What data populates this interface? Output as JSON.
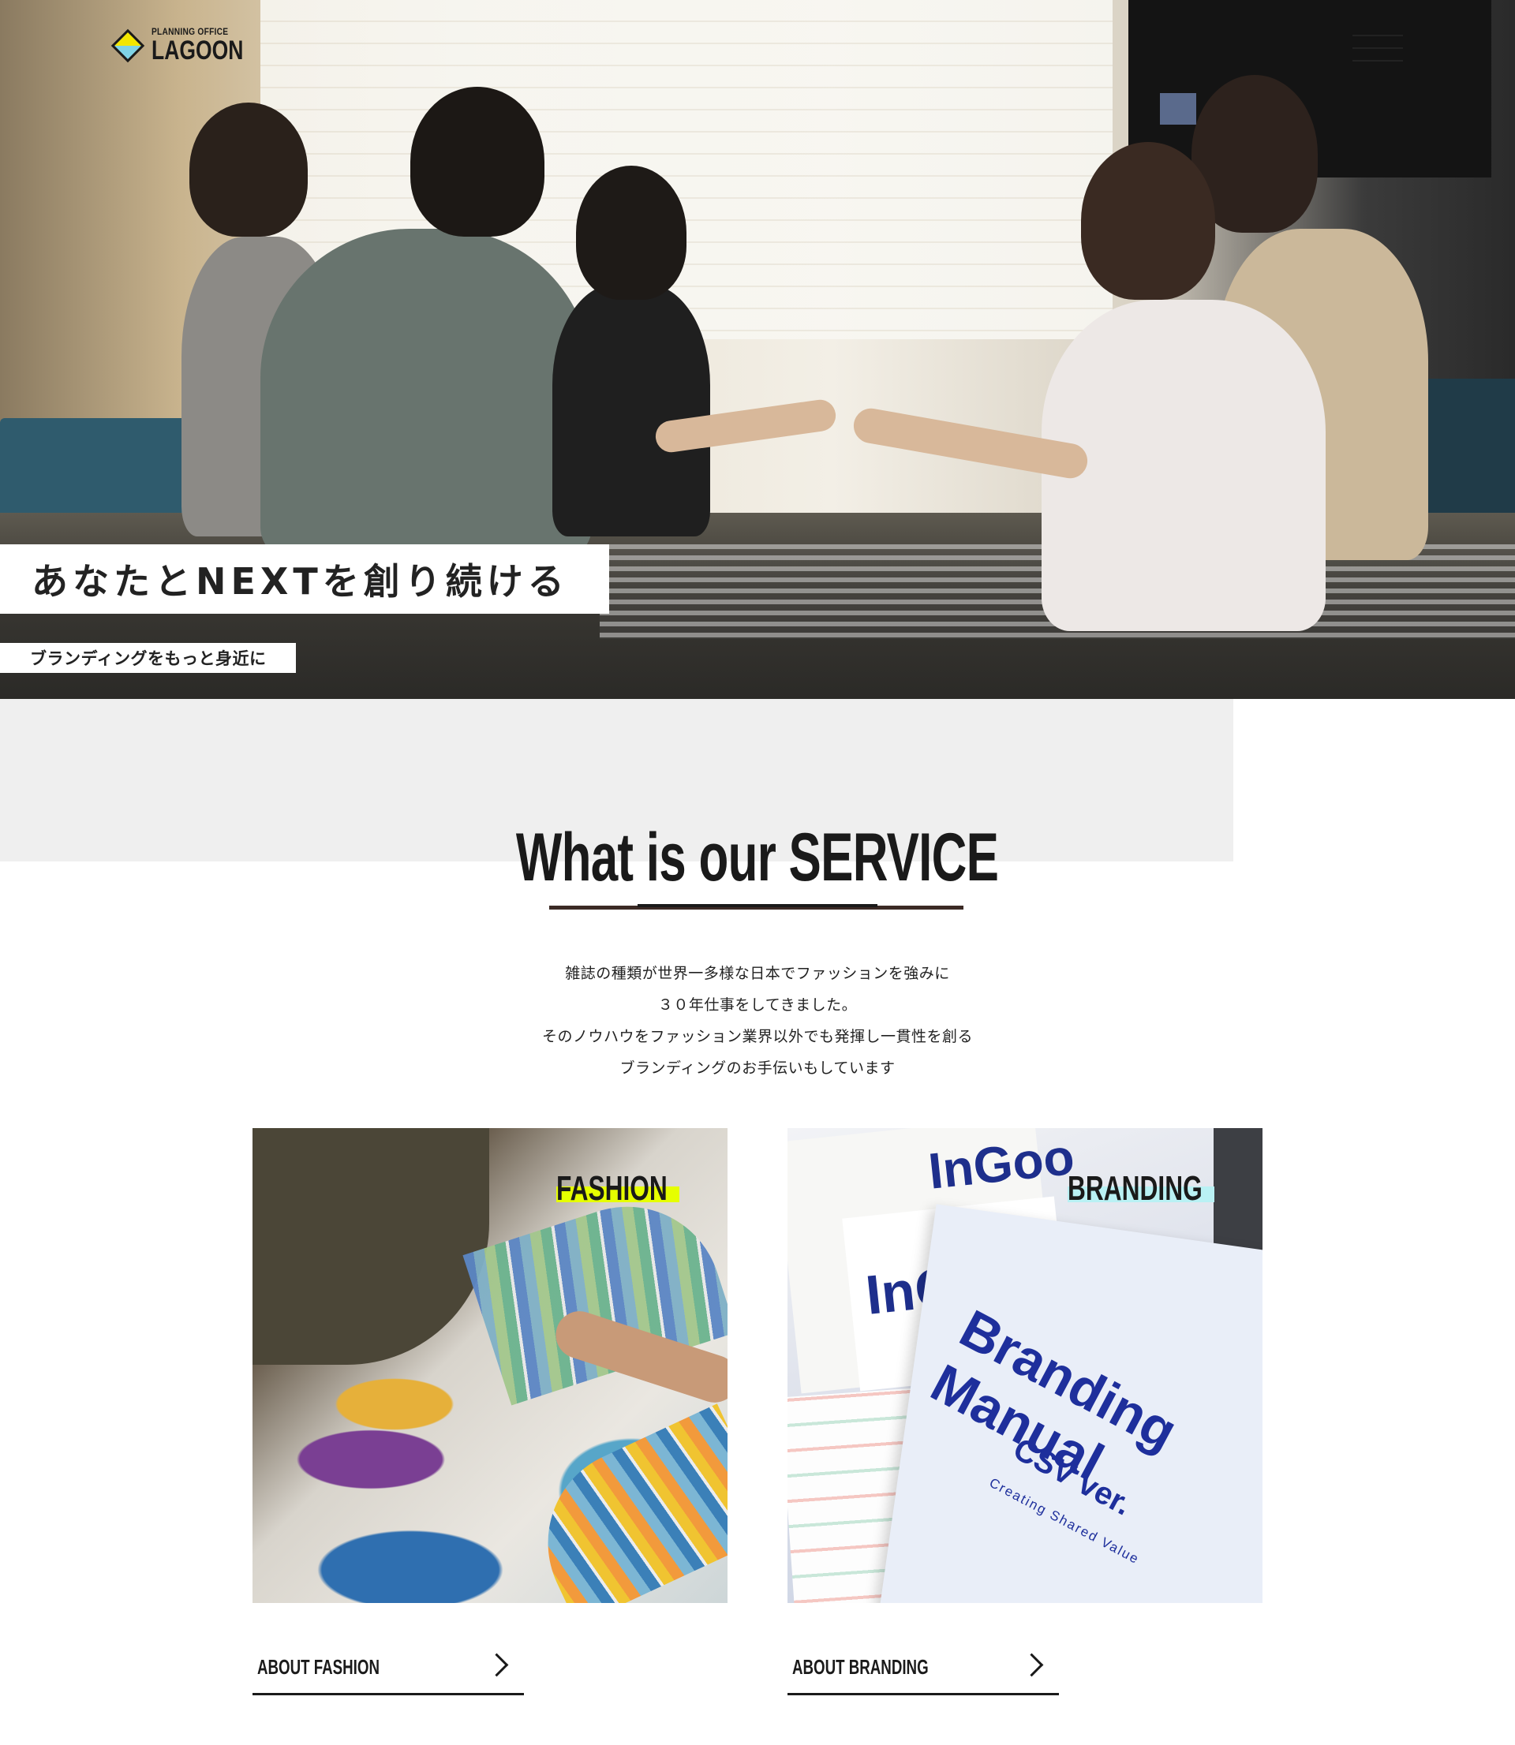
{
  "header": {
    "logo_small": "PLANNING OFFICE",
    "logo_big": "LAGOON",
    "menu_icon": "hamburger-menu-icon"
  },
  "hero": {
    "headline": "あなたとNEXTを創り続ける",
    "subline": "ブランディングをもっと身近に"
  },
  "service": {
    "title": "What is our SERVICE",
    "description": [
      "雑誌の種類が世界一多様な日本でファッションを強みに",
      "３０年仕事をしてきました。",
      "そのノウハウをファッション業界以外でも発揮し一貫性を創る",
      "ブランディングのお手伝いもしています"
    ],
    "cards": [
      {
        "label": "FASHION",
        "label_highlight": "#e6ff00",
        "link": "ABOUT FASHION",
        "link_icon": "chevron-right-icon"
      },
      {
        "label": "BRANDING",
        "label_highlight": "#b9f1f4",
        "link": "ABOUT BRANDING",
        "link_icon": "chevron-right-icon",
        "image_text": {
          "doc_title": "Branding Manual",
          "doc_sub": "CSV ver.",
          "doc_tag": "Creating Shared Value",
          "doc_logo": "InGoo",
          "doc_logo2": "InG"
        }
      }
    ]
  }
}
